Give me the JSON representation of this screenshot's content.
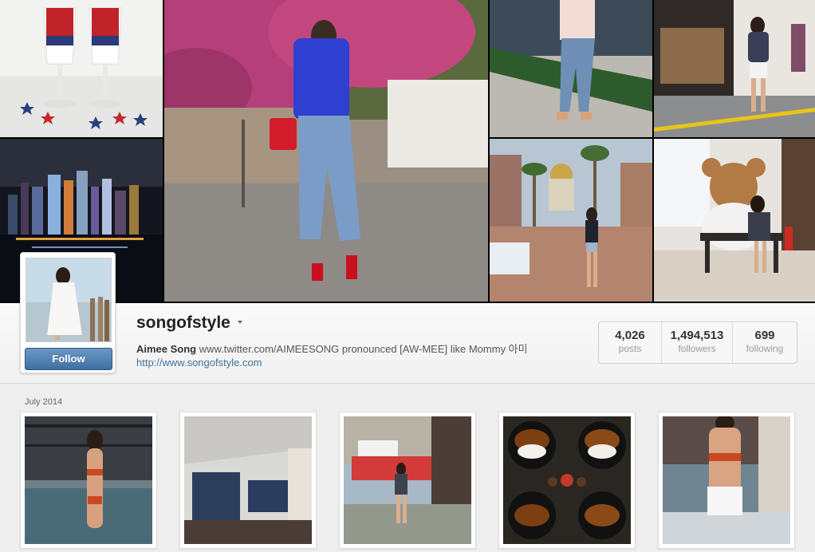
{
  "cover_photos": [
    {
      "subject": "strawberry-yogurt-parfaits"
    },
    {
      "subject": "woman-blue-top-by-bougainvillea"
    },
    {
      "subject": "woman-ripped-jeans-street"
    },
    {
      "subject": "woman-outside-shop"
    },
    {
      "subject": "city-skyline-night"
    },
    {
      "subject": "street-with-mosque-dome"
    },
    {
      "subject": "woman-with-teddy-bear"
    }
  ],
  "profile": {
    "username": "songofstyle",
    "full_name": "Aimee Song",
    "bio": "www.twitter.com/AIMEESONG pronounced [AW-MEE] like Mommy 아미",
    "website": "http://www.songofstyle.com",
    "follow_label": "Follow",
    "stats": [
      {
        "value": "4,026",
        "label": "posts"
      },
      {
        "value": "1,494,513",
        "label": "followers"
      },
      {
        "value": "699",
        "label": "following"
      }
    ]
  },
  "feed": {
    "month_label": "July 2014",
    "photos": [
      {
        "subject": "woman-bikini-poolside"
      },
      {
        "subject": "indoor-pool-architecture"
      },
      {
        "subject": "woman-on-street-corner"
      },
      {
        "subject": "curry-rice-plates-overhead"
      },
      {
        "subject": "woman-bikini-white-shorts"
      }
    ]
  },
  "colors": {
    "follow_button": "#4a7cb0",
    "link": "#3f729b",
    "background": "#eeeeee"
  }
}
